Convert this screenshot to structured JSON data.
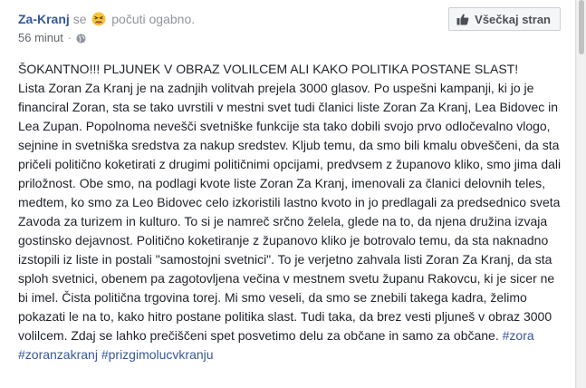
{
  "post": {
    "page_name": "Za-Kranj",
    "feeling_prefix": "se",
    "feeling_text": "počuti ogabno.",
    "time": "56 minut",
    "separator": "·",
    "like_button_label": "Všečkaj stran",
    "headline": "ŠOKANTNO!!! PLJUNEK V OBRAZ VOLILCEM ALI KAKO POLITIKA POSTANE SLAST!",
    "body": "Lista Zoran Za Kranj je na zadnjih volitvah prejela 3000 glasov. Po uspešni kampanji, ki jo je financiral Zoran, sta se tako uvrstili v mestni svet tudi članici liste Zoran Za Kranj, Lea Bidovec in Lea Zupan. Popolnoma nevešči svetniške funkcije sta tako dobili svojo prvo odločevalno vlogo, sejnine in svetniška sredstva za nakup sredstev. Kljub temu, da smo bili kmalu obveščeni, da sta pričeli politično koketirati z drugimi političnimi opcijami, predvsem z županovo kliko, smo jima dali priložnost. Obe smo, na podlagi kvote liste Zoran Za Kranj, imenovali za članici delovnih teles, medtem, ko smo za Leo Bidovec celo izkoristili lastno kvoto in jo predlagali za predsednico sveta Zavoda za turizem in kulturo. To si je namreč srčno želela, glede na to, da njena družina izvaja gostinsko dejavnost. Politično koketiranje z županovo kliko je botrovalo temu, da sta naknadno izstopili iz liste in postali \"samostojni svetnici\". To je verjetno zahvala listi Zoran Za Kranj, da sta sploh svetnici, obenem pa zagotovljena večina v mestnem svetu županu Rakovcu, ki je sicer ne bi imel. Čista politična trgovina torej. Mi smo veseli, da smo se znebili takega kadra, želimo pokazati le na to, kako hitro postane politika slast. Tudi taka, da brez vesti pljuneš v obraz 3000 volilcem. Zdaj se lahko prečiščeni spet posvetimo delu za občane in samo za občane.",
    "hashtags": [
      "#zora",
      "#zoranzakranj",
      "#prizgimolucvkranju"
    ]
  },
  "icons": {
    "feeling": "confounded-face-icon",
    "privacy": "globe-icon",
    "like": "thumbs-up-icon"
  },
  "colors": {
    "link": "#365899",
    "muted": "#90949c",
    "text": "#1d2129",
    "background": "#e9ebee"
  }
}
